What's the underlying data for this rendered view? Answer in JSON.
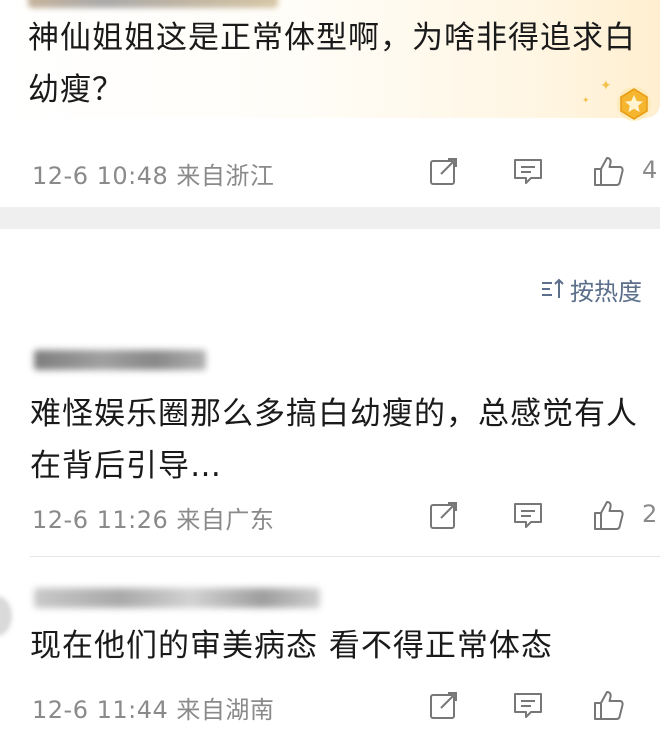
{
  "comments": [
    {
      "text": "神仙姐姐这是正常体型啊，为啥非得追求白幼瘦？",
      "time": "12-6 10:48",
      "location": "来自浙江",
      "likes": "4"
    },
    {
      "text": "难怪娱乐圈那么多搞白幼瘦的，总感觉有人在背后引导…",
      "time": "12-6 11:26",
      "location": "来自广东",
      "likes": "2"
    },
    {
      "text": "现在他们的审美病态 看不得正常体态",
      "time": "12-6 11:44",
      "location": "来自湖南",
      "likes": ""
    }
  ],
  "sort": {
    "label": "按热度"
  },
  "icons": {
    "share": "share-icon",
    "reply": "reply-icon",
    "like": "thumbs-up-icon",
    "sort": "sort-icon",
    "badge": "gold-badge-icon"
  },
  "colors": {
    "text": "#1a1a1a",
    "meta": "#8a8a8a",
    "sort": "#5b6e8a",
    "band": "#efefef",
    "bubble_highlight": "#ffefd0",
    "badge_gold": "#f5b52e"
  }
}
